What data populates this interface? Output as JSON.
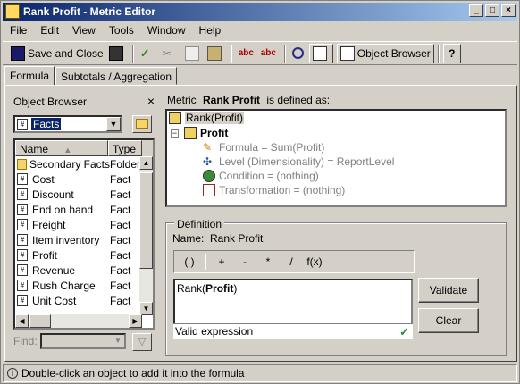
{
  "window": {
    "title": "Rank Profit - Metric Editor",
    "buttons": [
      "_",
      "□",
      "×"
    ]
  },
  "menu": [
    "File",
    "Edit",
    "View",
    "Tools",
    "Window",
    "Help"
  ],
  "toolbar": {
    "save_close": "Save and Close",
    "object_browser": "Object Browser"
  },
  "tabs": [
    "Formula",
    "Subtotals / Aggregation"
  ],
  "object_browser": {
    "title": "Object Browser",
    "folder": "Facts",
    "columns": [
      "Name",
      "Type"
    ],
    "rows": [
      {
        "name": "Secondary Facts",
        "type": "Folder",
        "icon": "folder"
      },
      {
        "name": "Cost",
        "type": "Fact",
        "icon": "fact"
      },
      {
        "name": "Discount",
        "type": "Fact",
        "icon": "fact"
      },
      {
        "name": "End on hand",
        "type": "Fact",
        "icon": "fact"
      },
      {
        "name": "Freight",
        "type": "Fact",
        "icon": "fact"
      },
      {
        "name": "Item inventory",
        "type": "Fact",
        "icon": "fact"
      },
      {
        "name": "Profit",
        "type": "Fact",
        "icon": "fact"
      },
      {
        "name": "Revenue",
        "type": "Fact",
        "icon": "fact"
      },
      {
        "name": "Rush Charge",
        "type": "Fact",
        "icon": "fact"
      },
      {
        "name": "Unit Cost",
        "type": "Fact",
        "icon": "fact"
      }
    ],
    "find_label": "Find:"
  },
  "metric": {
    "prefix": "Metric",
    "name": "Rank Profit",
    "suffix": "is defined as:",
    "tree": {
      "root": "Rank(Profit)",
      "child": "Profit",
      "formula": "Formula = Sum(Profit)",
      "level": "Level (Dimensionality) = ReportLevel",
      "condition": "Condition = (nothing)",
      "transformation": "Transformation = (nothing)"
    }
  },
  "definition": {
    "label": "Definition",
    "name_label": "Name:",
    "name_value": "Rank Profit",
    "operators": [
      "( )",
      "+",
      "-",
      "*",
      "/",
      "f(x)"
    ],
    "formula_prefix": "Rank(",
    "formula_bold": "Profit",
    "formula_suffix": ")",
    "status": "Valid expression",
    "validate": "Validate",
    "clear": "Clear"
  },
  "statusbar": "Double-click an object to add it into the formula"
}
